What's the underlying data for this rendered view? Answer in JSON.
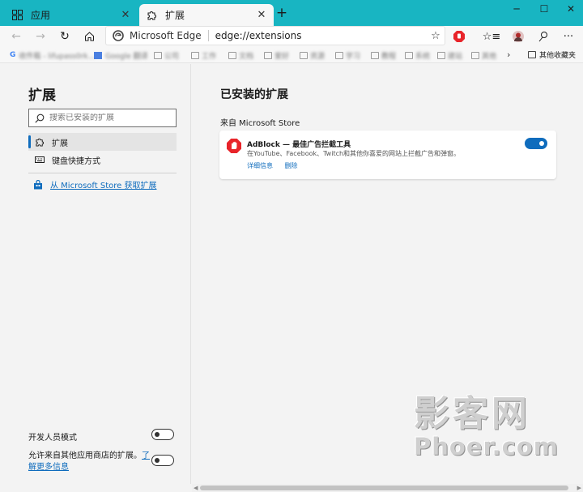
{
  "tabs": [
    {
      "label": "应用",
      "icon": "apps-grid-icon",
      "active": false
    },
    {
      "label": "扩展",
      "icon": "puzzle-icon",
      "active": true
    }
  ],
  "toolbar": {
    "site_name": "Microsoft Edge",
    "url": "edge://extensions"
  },
  "bookmarks": {
    "items": [
      "收件箱 - lifupass0rk...",
      "Google 翻译",
      "公司",
      "工作",
      "文档",
      "爱好",
      "资源",
      "学习",
      "教程",
      "系统",
      "建站",
      "其他"
    ],
    "other_label": "其他收藏夹"
  },
  "sidebar": {
    "title": "扩展",
    "search_placeholder": "搜索已安装的扩展",
    "items": [
      {
        "label": "扩展",
        "selected": true
      },
      {
        "label": "键盘快捷方式",
        "selected": false
      }
    ],
    "store_link": "从 Microsoft Store 获取扩展",
    "developer_mode": "开发人员模式",
    "allow_other_stores": "允许来自其他应用商店的扩展。",
    "learn_more_1": "了",
    "learn_more_2": "解更多信息"
  },
  "main": {
    "title": "已安装的扩展",
    "source": "来自 Microsoft Store",
    "extensions": [
      {
        "name": "AdBlock — 最佳广告拦截工具",
        "description": "在YouTube、Facebook、Twitch和其他你喜爱的网站上拦截广告和弹窗。",
        "details_label": "详细信息",
        "remove_label": "删除",
        "enabled": true
      }
    ]
  },
  "watermark": {
    "line1": "影客网",
    "line2": "Phoer.com"
  },
  "colors": {
    "titlebar": "#18b5c2",
    "accent": "#0f6cbd",
    "adblock_red": "#e8242a"
  }
}
